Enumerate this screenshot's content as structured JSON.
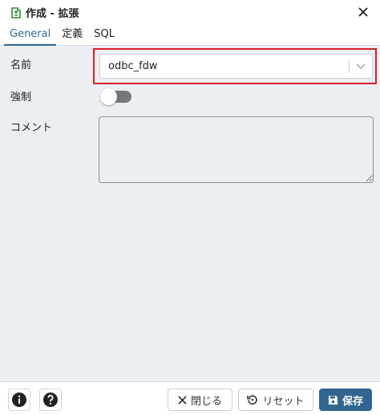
{
  "dialog": {
    "title": "作成 - 拡張"
  },
  "tabs": [
    {
      "label": "General",
      "active": true
    },
    {
      "label": "定義",
      "active": false
    },
    {
      "label": "SQL",
      "active": false
    }
  ],
  "form": {
    "name_label": "名前",
    "name_value": "odbc_fdw",
    "force_label": "強制",
    "force_enabled": false,
    "comment_label": "コメント",
    "comment_value": ""
  },
  "footer": {
    "close_label": "閉じる",
    "reset_label": "リセット",
    "save_label": "保存"
  },
  "colors": {
    "accent": "#326690",
    "highlight": "#d9202b",
    "panel_bg": "#ebeef3"
  }
}
